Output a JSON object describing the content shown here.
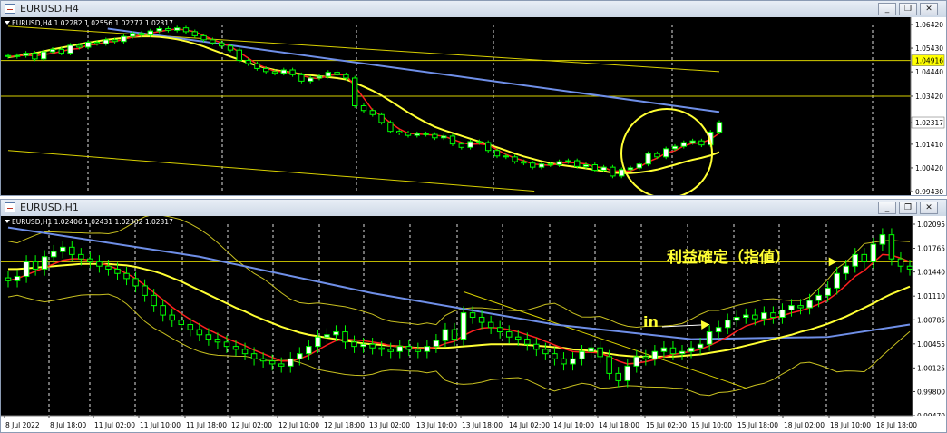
{
  "windows": [
    {
      "title": "EURUSD,H4",
      "info": "EURUSD,H4  1.02282 1.02556 1.02277 1.02317",
      "buttons": [
        "_",
        "❐",
        "✕"
      ]
    },
    {
      "title": "EURUSD,H1",
      "info": "EURUSD,H1  1.02406 1.02431 1.02302 1.02317",
      "buttons": [
        "_",
        "❐",
        "✕"
      ]
    }
  ],
  "colors": {
    "background": "#000000",
    "bull_candle": "#ffffff",
    "bear_candle": "#000000",
    "candle_outline": "#00ff00",
    "ma_red": "#ff2020",
    "ma_yellow": "#ffff33",
    "ma_blue": "#6f8fe8",
    "bollinger": "#c8c020",
    "hline": "#d8d000",
    "price_label_bg": "#ffff00",
    "annotation": "#ffff33"
  },
  "chart_data": [
    {
      "type": "candlestick",
      "symbol": "EURUSD",
      "timeframe": "H4",
      "ohlc_last": {
        "open": 1.02282,
        "high": 1.02556,
        "low": 1.02277,
        "close": 1.02317
      },
      "ylim": [
        0.9943,
        1.0642
      ],
      "yticks": [
        "1.06420",
        "1.05430",
        "1.04440",
        "1.03420",
        "1.02317",
        "1.01410",
        "1.00420",
        "0.99430"
      ],
      "price_labels": [
        {
          "text": "1.04916",
          "value": 1.04916
        },
        {
          "text": "1.02317",
          "value": 1.02317
        }
      ],
      "hlines": [
        1.04916,
        1.0342
      ],
      "trendlines": [
        {
          "x": [
            0,
            100
          ],
          "y": [
            1.0635,
            1.0445
          ]
        },
        {
          "x": [
            0,
            74
          ],
          "y": [
            1.0115,
            0.9945
          ]
        }
      ],
      "annotations": [
        {
          "type": "circle",
          "note": "circled recent bottom"
        }
      ],
      "closes": [
        1.0508,
        1.0512,
        1.0522,
        1.0498,
        1.0528,
        1.0538,
        1.0522,
        1.0555,
        1.0547,
        1.0568,
        1.0562,
        1.0578,
        1.0571,
        1.0592,
        1.0605,
        1.0598,
        1.0615,
        1.0625,
        1.0618,
        1.0628,
        1.0612,
        1.0595,
        1.0578,
        1.0565,
        1.0552,
        1.0535,
        1.0492,
        1.0478,
        1.0458,
        1.0445,
        1.0438,
        1.0452,
        1.0432,
        1.0405,
        1.0418,
        1.0425,
        1.0442,
        1.0432,
        1.0418,
        1.0302,
        1.0282,
        1.0265,
        1.0232,
        1.0195,
        1.0188,
        1.0178,
        1.0185,
        1.0182,
        1.0168,
        1.0175,
        1.0142,
        1.0128,
        1.0152,
        1.0148,
        1.0115,
        1.0092,
        1.0088,
        1.0068,
        1.0062,
        1.0045,
        1.0058,
        1.0055,
        1.0068,
        1.0072,
        1.0048,
        1.0055,
        1.0032,
        1.0045,
        1.0008,
        1.0035,
        1.0042,
        1.0058,
        1.0102,
        1.0088,
        1.0122,
        1.0132,
        1.0148,
        1.0155,
        1.0138,
        1.0192,
        1.0232
      ],
      "ma_yellow": [
        1.0505,
        1.051,
        1.0516,
        1.0522,
        1.053,
        1.0538,
        1.0545,
        1.0552,
        1.056,
        1.0566,
        1.0572,
        1.0578,
        1.0582,
        1.0586,
        1.059,
        1.0592,
        1.0592,
        1.059,
        1.0586,
        1.058,
        1.0572,
        1.0562,
        1.055,
        1.0536,
        1.0522,
        1.0508,
        1.0495,
        1.0482,
        1.047,
        1.046,
        1.0452,
        1.0446,
        1.044,
        1.0434,
        1.043,
        1.0426,
        1.0422,
        1.0418,
        1.0412,
        1.0398,
        1.0382,
        1.0365,
        1.0345,
        1.0322,
        1.0298,
        1.0274,
        1.0252,
        1.0232,
        1.0214,
        1.02,
        1.0188,
        1.0176,
        1.0164,
        1.0152,
        1.014,
        1.0128,
        1.0115,
        1.0102,
        1.009,
        1.008,
        1.007,
        1.0062,
        1.0055,
        1.005,
        1.0045,
        1.004,
        1.0034,
        1.0028,
        1.0022,
        1.002,
        1.002,
        1.0023,
        1.0028,
        1.0035,
        1.0045,
        1.0055,
        1.0066,
        1.0076,
        1.0084,
        1.0094,
        1.0108
      ],
      "ma_blue": [
        [
          14,
          1.0625
        ],
        [
          100,
          1.0276
        ]
      ]
    },
    {
      "type": "candlestick",
      "symbol": "EURUSD",
      "timeframe": "H1",
      "ohlc_last": {
        "open": 1.02406,
        "high": 1.02431,
        "low": 1.02302,
        "close": 1.02317
      },
      "ylim": [
        0.9947,
        1.02095
      ],
      "yticks": [
        "1.02095",
        "1.01765",
        "1.01440",
        "1.01110",
        "1.00785",
        "1.00455",
        "1.00125",
        "0.99800",
        "0.99470"
      ],
      "xticks": [
        "8 Jul 2022",
        "8 Jul 18:00",
        "11 Jul 02:00",
        "11 Jul 10:00",
        "11 Jul 18:00",
        "12 Jul 02:00",
        "12 Jul 10:00",
        "12 Jul 18:00",
        "13 Jul 02:00",
        "13 Jul 10:00",
        "13 Jul 18:00",
        "14 Jul 02:00",
        "14 Jul 10:00",
        "14 Jul 18:00",
        "15 Jul 02:00",
        "15 Jul 10:00",
        "15 Jul 18:00",
        "18 Jul 02:00",
        "18 Jul 10:00",
        "18 Jul 18:00"
      ],
      "hlines": [
        1.0158
      ],
      "trendlines": [
        {
          "x": [
            50,
            81
          ],
          "y": [
            1.0117,
            0.9985
          ]
        }
      ],
      "annotations": [
        {
          "text": "利益確定（指値）",
          "arrow_to": [
            91,
            1.0158
          ]
        },
        {
          "text": "in",
          "arrow_to": [
            77,
            1.0072
          ]
        }
      ],
      "closes": [
        1.0132,
        1.0138,
        1.0158,
        1.0148,
        1.0165,
        1.0172,
        1.0178,
        1.0168,
        1.0162,
        1.0158,
        1.0152,
        1.0148,
        1.0142,
        1.0135,
        1.0125,
        1.0112,
        1.0098,
        1.0085,
        1.0078,
        1.0072,
        1.0065,
        1.0058,
        1.0052,
        1.0048,
        1.0042,
        1.0038,
        1.0032,
        1.0025,
        1.0022,
        1.0018,
        1.0015,
        1.0025,
        1.0032,
        1.0042,
        1.0055,
        1.0058,
        1.0062,
        1.0048,
        1.0042,
        1.0045,
        1.004,
        1.0038,
        1.0035,
        1.0042,
        1.0038,
        1.0035,
        1.0042,
        1.005,
        1.0065,
        1.0052,
        1.0088,
        1.0082,
        1.0075,
        1.0068,
        1.0062,
        1.0055,
        1.0052,
        1.0045,
        1.0038,
        1.0032,
        1.0025,
        1.0018,
        1.0025,
        1.0035,
        1.004,
        1.0028,
        1.0005,
        0.9995,
        1.0015,
        1.0028,
        1.0025,
        1.0035,
        1.004,
        1.0032,
        1.0035,
        1.004,
        1.0045,
        1.0062,
        1.0068,
        1.0078,
        1.0082,
        1.0085,
        1.008,
        1.0088,
        1.0082,
        1.0092,
        1.0098,
        1.0095,
        1.0105,
        1.0112,
        1.0122,
        1.0142,
        1.0152,
        1.0168,
        1.0158,
        1.0182,
        1.0195,
        1.0162,
        1.0152,
        1.0148
      ],
      "ma_red": [
        1.0132,
        1.0135,
        1.014,
        1.0145,
        1.015,
        1.0155,
        1.016,
        1.0162,
        1.0162,
        1.016,
        1.0157,
        1.0153,
        1.0148,
        1.0142,
        1.0135,
        1.0126,
        1.0116,
        1.0106,
        1.0096,
        1.0087,
        1.0079,
        1.0072,
        1.0065,
        1.0059,
        1.0053,
        1.0048,
        1.0043,
        1.0037,
        1.0032,
        1.0027,
        1.0022,
        1.0022,
        1.0025,
        1.003,
        1.0037,
        1.0044,
        1.005,
        1.0052,
        1.0051,
        1.005,
        1.0048,
        1.0046,
        1.0043,
        1.0042,
        1.0041,
        1.0039,
        1.0039,
        1.0041,
        1.0046,
        1.0049,
        1.0057,
        1.0063,
        1.0067,
        1.0068,
        1.0067,
        1.0065,
        1.0062,
        1.0058,
        1.0054,
        1.0049,
        1.0044,
        1.0039,
        1.0035,
        1.0034,
        1.0034,
        1.0033,
        1.0028,
        1.0022,
        1.0018,
        1.0019,
        1.0021,
        1.0024,
        1.0028,
        1.0031,
        1.0033,
        1.0035,
        1.0038,
        1.0043,
        1.0049,
        1.0055,
        1.0063,
        1.007,
        1.0074,
        1.0078,
        1.0081,
        1.0084,
        1.0088,
        1.0091,
        1.0095,
        1.01,
        1.0106,
        1.0115,
        1.0126,
        1.0138,
        1.0146,
        1.0157,
        1.0168,
        1.0167,
        1.0163,
        1.0158
      ],
      "ma_yellow": [
        1.0148,
        1.0148,
        1.0149,
        1.015,
        1.0151,
        1.0152,
        1.0153,
        1.0154,
        1.0155,
        1.0155,
        1.0155,
        1.0155,
        1.0154,
        1.0153,
        1.0151,
        1.0148,
        1.0145,
        1.0141,
        1.0136,
        1.0131,
        1.0125,
        1.0119,
        1.0113,
        1.0107,
        1.0101,
        1.0095,
        1.009,
        1.0084,
        1.0079,
        1.0074,
        1.0069,
        1.0065,
        1.0061,
        1.0058,
        1.0056,
        1.0054,
        1.0052,
        1.005,
        1.0048,
        1.0046,
        1.0045,
        1.0044,
        1.0043,
        1.0042,
        1.0041,
        1.004,
        1.004,
        1.004,
        1.004,
        1.0041,
        1.0042,
        1.0043,
        1.0044,
        1.0045,
        1.0045,
        1.0045,
        1.0045,
        1.0044,
        1.0043,
        1.0042,
        1.0041,
        1.004,
        1.0038,
        1.0037,
        1.0036,
        1.0034,
        1.0032,
        1.003,
        1.0029,
        1.0028,
        1.0028,
        1.0028,
        1.0028,
        1.0028,
        1.0029,
        1.003,
        1.0031,
        1.0033,
        1.0035,
        1.0037,
        1.004,
        1.0043,
        1.0046,
        1.0049,
        1.0052,
        1.0055,
        1.0058,
        1.0062,
        1.0065,
        1.0069,
        1.0073,
        1.0078,
        1.0083,
        1.0089,
        1.0095,
        1.0101,
        1.0108,
        1.0114,
        1.0119,
        1.0124
      ],
      "ma_blue": [
        [
          0,
          1.0205
        ],
        [
          21,
          1.0165
        ],
        [
          40,
          1.0115
        ],
        [
          60,
          1.0072
        ],
        [
          75,
          1.0052
        ],
        [
          90,
          1.0055
        ],
        [
          99,
          1.0072
        ]
      ]
    }
  ]
}
